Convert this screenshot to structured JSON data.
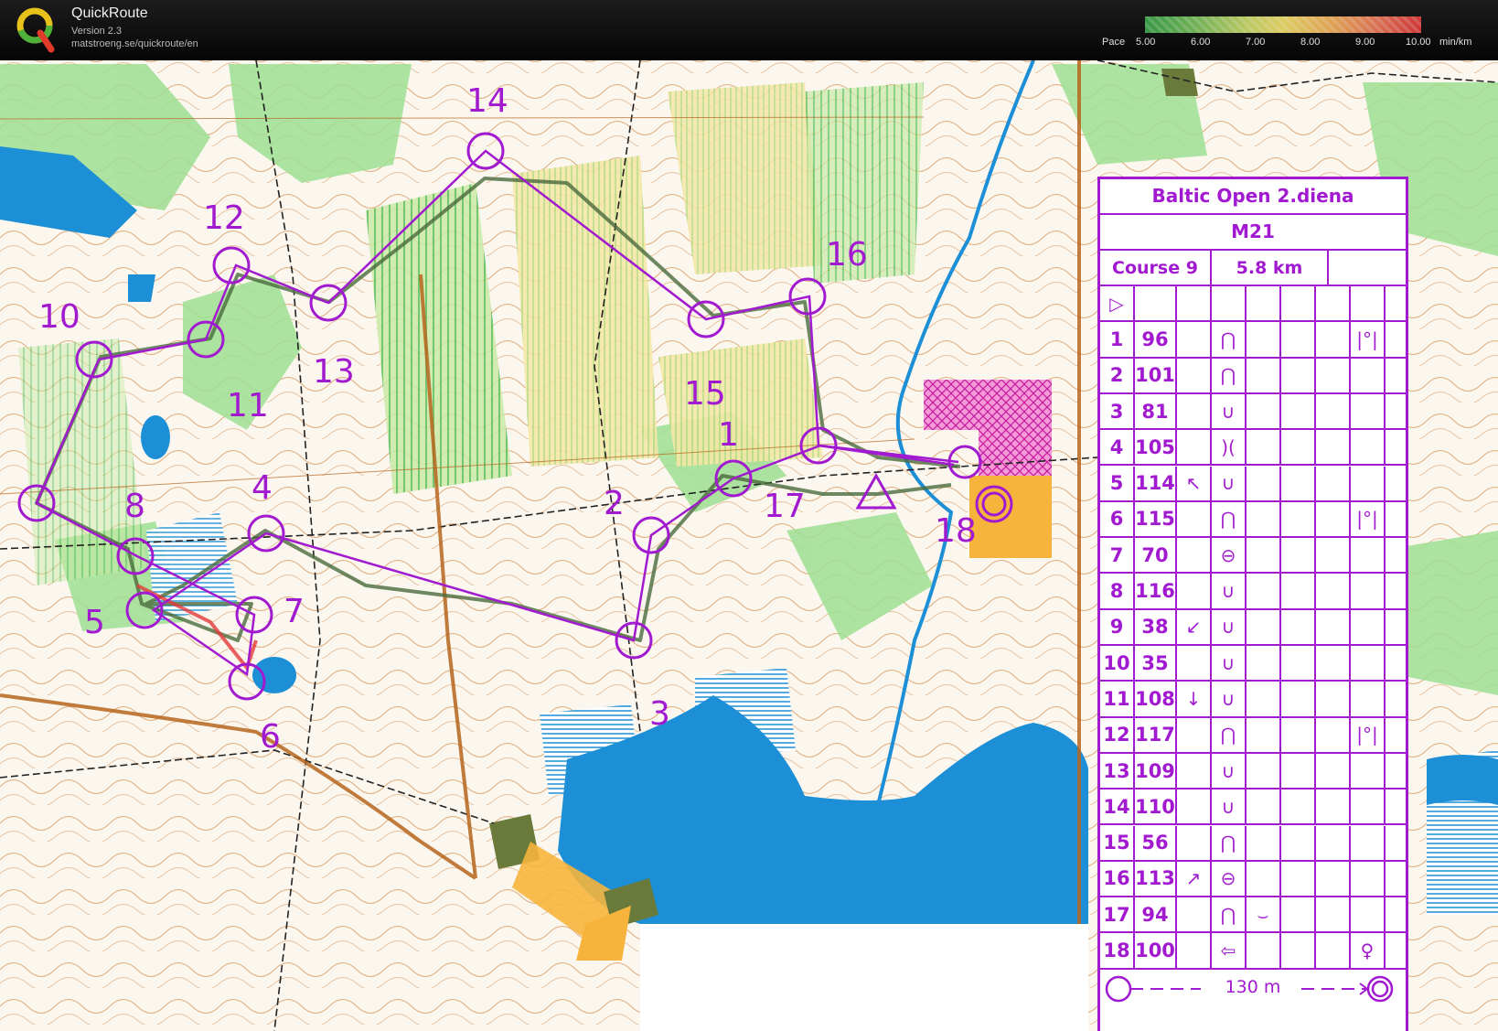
{
  "header": {
    "app_name": "QuickRoute",
    "version": "Version 2.3",
    "url": "matstroeng.se/quickroute/en",
    "pace_label": "Pace",
    "pace_ticks": [
      "5.00",
      "6.00",
      "7.00",
      "8.00",
      "9.00",
      "10.00"
    ],
    "pace_unit": "min/km"
  },
  "map": {
    "control_labels": [
      "1",
      "2",
      "3",
      "4",
      "5",
      "6",
      "7",
      "8",
      "10",
      "11",
      "12",
      "13",
      "14",
      "15",
      "16",
      "17",
      "18"
    ],
    "colors": {
      "course_purple": "#a21ad0",
      "water_blue": "#1c8fd6",
      "vegetation_green": "#8fd88a",
      "contour_brown": "#b5651d",
      "route_line": "#4a6a3c"
    }
  },
  "control_descriptions": {
    "event": "Baltic Open 2.diena",
    "class": "M21",
    "course": "Course 9",
    "length": "5.8 km",
    "start_symbol": "▷",
    "rows": [
      {
        "n": "1",
        "code": "96",
        "dir": "",
        "feature": "⋂",
        "extra": "",
        "note": "|°|"
      },
      {
        "n": "2",
        "code": "101",
        "dir": "",
        "feature": "⋂",
        "extra": "",
        "note": ""
      },
      {
        "n": "3",
        "code": "81",
        "dir": "",
        "feature": "∪",
        "extra": "",
        "note": ""
      },
      {
        "n": "4",
        "code": "105",
        "dir": "",
        "feature": ")(",
        "extra": "",
        "note": ""
      },
      {
        "n": "5",
        "code": "114",
        "dir": "↖",
        "feature": "∪",
        "extra": "",
        "note": ""
      },
      {
        "n": "6",
        "code": "115",
        "dir": "",
        "feature": "⋂",
        "extra": "",
        "note": "|°|"
      },
      {
        "n": "7",
        "code": "70",
        "dir": "",
        "feature": "⊖",
        "extra": "",
        "note": ""
      },
      {
        "n": "8",
        "code": "116",
        "dir": "",
        "feature": "∪",
        "extra": "",
        "note": ""
      },
      {
        "n": "9",
        "code": "38",
        "dir": "↙",
        "feature": "∪",
        "extra": "",
        "note": ""
      },
      {
        "n": "10",
        "code": "35",
        "dir": "",
        "feature": "∪",
        "extra": "",
        "note": ""
      },
      {
        "n": "11",
        "code": "108",
        "dir": "↓",
        "feature": "∪",
        "extra": "",
        "note": ""
      },
      {
        "n": "12",
        "code": "117",
        "dir": "",
        "feature": "⋂",
        "extra": "",
        "note": "|°|"
      },
      {
        "n": "13",
        "code": "109",
        "dir": "",
        "feature": "∪",
        "extra": "",
        "note": ""
      },
      {
        "n": "14",
        "code": "110",
        "dir": "",
        "feature": "∪",
        "extra": "",
        "note": ""
      },
      {
        "n": "15",
        "code": "56",
        "dir": "",
        "feature": "⋂",
        "extra": "",
        "note": ""
      },
      {
        "n": "16",
        "code": "113",
        "dir": "↗",
        "feature": "⊖",
        "extra": "",
        "note": ""
      },
      {
        "n": "17",
        "code": "94",
        "dir": "",
        "feature": "⋂",
        "extra": "⌣",
        "note": ""
      },
      {
        "n": "18",
        "code": "100",
        "dir": "",
        "feature": "⇦",
        "extra": "",
        "note": "♀"
      }
    ],
    "finish_distance": "130 m"
  }
}
